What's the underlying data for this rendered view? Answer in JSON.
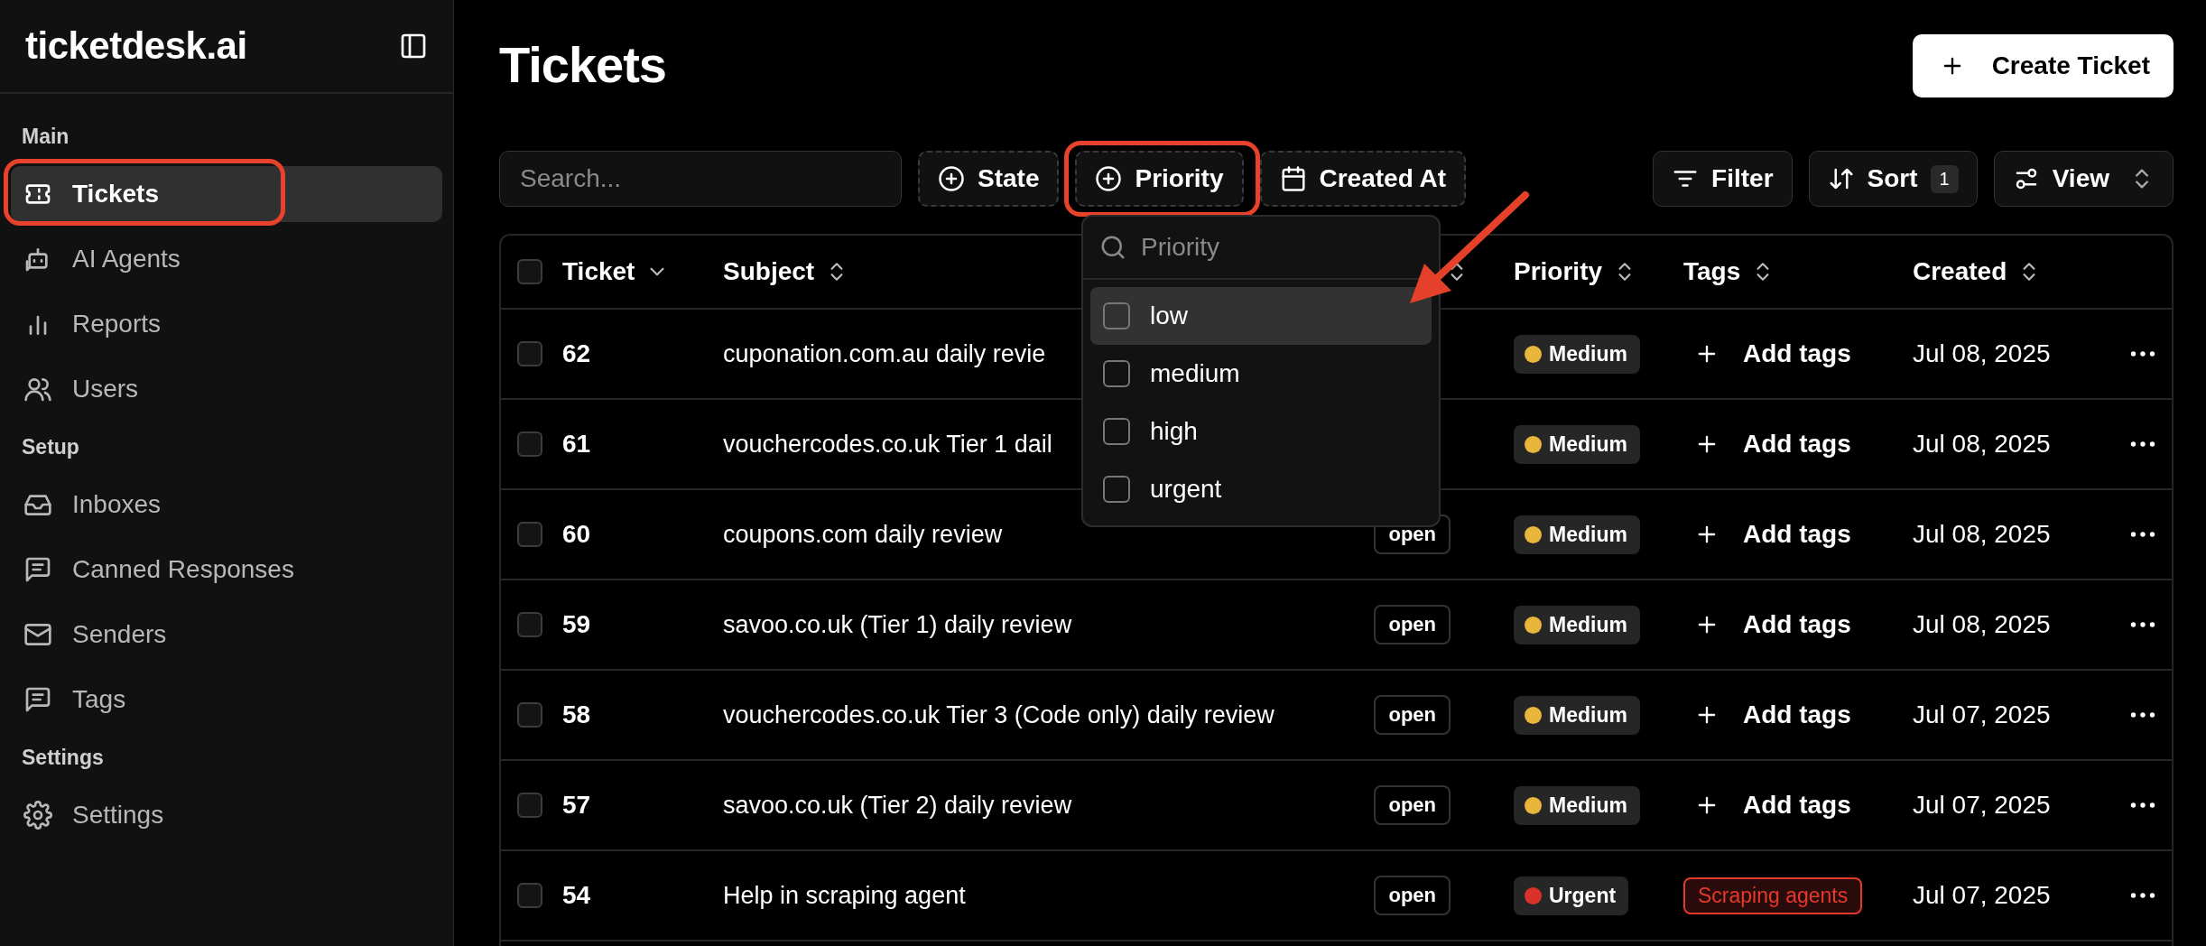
{
  "sidebar": {
    "logo": "ticketdesk.ai",
    "sections": [
      {
        "label": "Main",
        "items": [
          {
            "label": "Tickets",
            "selected": true,
            "highlighted": true
          },
          {
            "label": "AI Agents",
            "selected": false,
            "highlighted": false
          },
          {
            "label": "Reports",
            "selected": false,
            "highlighted": false
          },
          {
            "label": "Users",
            "selected": false,
            "highlighted": false
          }
        ]
      },
      {
        "label": "Setup",
        "items": [
          {
            "label": "Inboxes",
            "selected": false,
            "highlighted": false
          },
          {
            "label": "Canned Responses",
            "selected": false,
            "highlighted": false
          },
          {
            "label": "Senders",
            "selected": false,
            "highlighted": false
          },
          {
            "label": "Tags",
            "selected": false,
            "highlighted": false
          }
        ]
      },
      {
        "label": "Settings",
        "items": [
          {
            "label": "Settings",
            "selected": false,
            "highlighted": false
          }
        ]
      }
    ]
  },
  "header": {
    "title": "Tickets",
    "create_button": "Create Ticket"
  },
  "toolbar": {
    "search": {
      "placeholder": "Search..."
    },
    "filters": [
      {
        "label": "State",
        "highlighted": false
      },
      {
        "label": "Priority",
        "highlighted": true
      },
      {
        "label": "Created At",
        "highlighted": false
      }
    ],
    "actions": [
      {
        "label": "Filter"
      },
      {
        "label": "Sort",
        "badge": "1"
      },
      {
        "label": "View"
      }
    ]
  },
  "table": {
    "header_checked": false,
    "columns": [
      {
        "label": "Ticket",
        "sorted": true
      },
      {
        "label": "Subject",
        "sorted": false
      },
      {
        "sorted": false
      },
      {
        "label": "Priority",
        "sorted": false
      },
      {
        "label": "Tags",
        "sorted": false
      },
      {
        "label": "Created",
        "sorted": false
      }
    ],
    "rows": [
      {
        "ticket": "62",
        "subject": "cuponation.com.au daily revie",
        "checked": false,
        "priority": {
          "label": "Medium",
          "color": "#e8b63c"
        },
        "add_tags": "Add tags",
        "created": "Jul 08, 2025"
      },
      {
        "ticket": "61",
        "subject": "vouchercodes.co.uk Tier 1 dail",
        "checked": false,
        "priority": {
          "label": "Medium",
          "color": "#e8b63c"
        },
        "add_tags": "Add tags",
        "created": "Jul 08, 2025"
      },
      {
        "ticket": "60",
        "subject": "coupons.com daily review",
        "checked": false,
        "status": "open",
        "priority": {
          "label": "Medium",
          "color": "#e8b63c"
        },
        "add_tags": "Add tags",
        "created": "Jul 08, 2025"
      },
      {
        "ticket": "59",
        "subject": "savoo.co.uk (Tier 1) daily review",
        "checked": false,
        "status": "open",
        "priority": {
          "label": "Medium",
          "color": "#e8b63c"
        },
        "add_tags": "Add tags",
        "created": "Jul 08, 2025"
      },
      {
        "ticket": "58",
        "subject": "vouchercodes.co.uk Tier 3 (Code only) daily review",
        "checked": false,
        "status": "open",
        "priority": {
          "label": "Medium",
          "color": "#e8b63c"
        },
        "add_tags": "Add tags",
        "created": "Jul 07, 2025"
      },
      {
        "ticket": "57",
        "subject": "savoo.co.uk (Tier 2) daily review",
        "checked": false,
        "status": "open",
        "priority": {
          "label": "Medium",
          "color": "#e8b63c"
        },
        "add_tags": "Add tags",
        "created": "Jul 07, 2025"
      },
      {
        "ticket": "54",
        "subject": "Help in scraping agent",
        "checked": false,
        "status": "open",
        "priority": {
          "label": "Urgent",
          "color": "#d8322a"
        },
        "tags": [
          {
            "label": "Scraping agents",
            "color": "#e5392b"
          }
        ],
        "created": "Jul 07, 2025"
      }
    ]
  },
  "dropdown": {
    "placeholder": "Priority",
    "options": [
      {
        "label": "low",
        "checked": false,
        "selected": true,
        "pointed": true
      },
      {
        "label": "medium",
        "checked": false,
        "selected": false,
        "pointed": false
      },
      {
        "label": "high",
        "checked": false,
        "selected": false,
        "pointed": false
      },
      {
        "label": "urgent",
        "checked": false,
        "selected": false,
        "pointed": false
      }
    ]
  }
}
